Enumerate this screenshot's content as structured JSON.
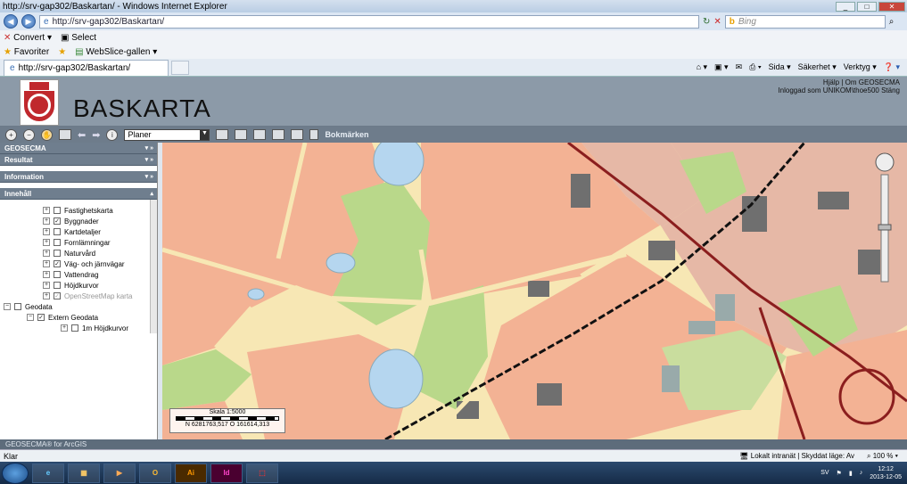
{
  "window": {
    "title": "http://srv-gap302/Baskartan/ - Windows Internet Explorer"
  },
  "address": {
    "url": "http://srv-gap302/Baskartan/",
    "search_provider": "Bing",
    "search_placeholder": "Bing"
  },
  "commandbar": {
    "convert_label": "Convert",
    "select_label": "Select"
  },
  "favorites": {
    "label": "Favoriter",
    "webslice_label": "WebSlice-gallen"
  },
  "tab": {
    "label": "http://srv-gap302/Baskartan/"
  },
  "ie_tools": {
    "page_label": "Sida",
    "security_label": "Säkerhet",
    "tools_label": "Verktyg"
  },
  "app": {
    "title": "BASKARTA",
    "help_link": "Hjälp",
    "about_link": "Om GEOSECMA",
    "login_text": "Inloggad som UNIKOM\\thoe500",
    "close_link": "Stäng",
    "separator": "|"
  },
  "toolbar": {
    "layer_select_value": "Planer",
    "bookmarks_label": "Bokmärken"
  },
  "side_panel": {
    "sections": [
      "GEOSECMA",
      "Resultat",
      "Information",
      "Innehåll"
    ],
    "tree": [
      {
        "label": "Fastighetskarta",
        "checked": false
      },
      {
        "label": "Byggnader",
        "checked": true
      },
      {
        "label": "Kartdetaljer",
        "checked": false
      },
      {
        "label": "Fornlämningar",
        "checked": false
      },
      {
        "label": "Naturvård",
        "checked": false
      },
      {
        "label": "Väg- och järnvägar",
        "checked": true
      },
      {
        "label": "Vattendrag",
        "checked": false
      },
      {
        "label": "Höjdkurvor",
        "checked": false
      },
      {
        "label": "OpenStreetMap karta",
        "checked": true
      }
    ],
    "geodata_label": "Geodata",
    "extern_label": "Extern Geodata",
    "hojd_label": "1m Höjdkurvor"
  },
  "map": {
    "scale_text": "Skala 1:5000",
    "coords_text": "N 6281763,517  O 161614,313",
    "colors": {
      "residential": "#f3b294",
      "park": "#b9d88a",
      "water": "#b5d6ef",
      "building": "#6f6f6f",
      "rail": "#111111",
      "mainroad": "#8b1e1e",
      "base": "#f7e7b4"
    }
  },
  "footer": {
    "brand": "GEOSECMA® for ArcGIS"
  },
  "statusbar": {
    "left": "Klar",
    "zone": "Lokalt intranät | Skyddat läge: Av",
    "zoom": "100 %"
  },
  "taskbar": {
    "lang": "SV",
    "time": "12:12",
    "date": "2013-12-05"
  }
}
